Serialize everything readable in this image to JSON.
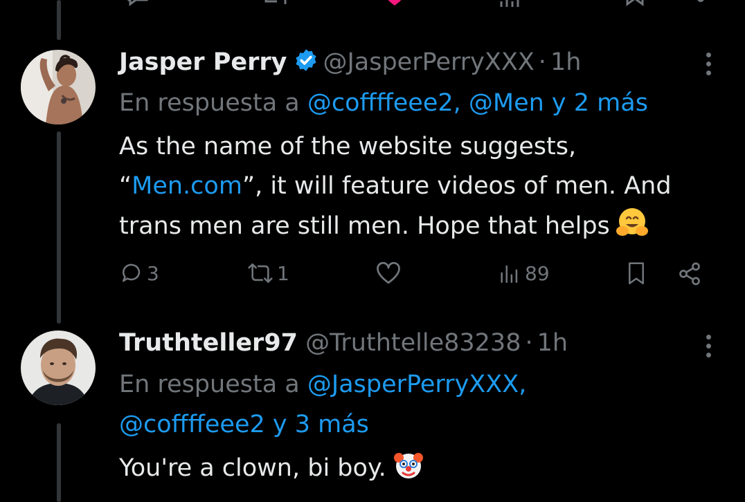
{
  "tweets": [
    {
      "name": "Jasper Perry",
      "handle": "@JasperPerryXXX",
      "separator": "·",
      "time": "1h",
      "reply_prefix": "En respuesta a",
      "reply_mentions": "@coffffeee2, @Men y 2 más",
      "body_prefix": "As the name of the website suggests,",
      "body_quote_open": "“",
      "body_link": "Men.com",
      "body_after_link": "”, it will feature videos of men. And",
      "body_line3": "trans men are still men. Hope that helps",
      "emoji": "hugging-face",
      "stats": {
        "replies": "3",
        "reposts": "1",
        "views": "89"
      }
    },
    {
      "name": "Truthteller97",
      "handle": "@Truthtelle83238",
      "separator": "·",
      "time": "1h",
      "reply_prefix": "En respuesta a",
      "reply_mentions_line1": "@JasperPerryXXX,",
      "reply_mentions_line2": "@coffffeee2 y 3 más",
      "body": "You're a clown, bi boy.",
      "emoji": "clown-face"
    }
  ],
  "colors": {
    "background": "#000000",
    "text": "#e7e9ea",
    "muted": "#71767b",
    "accent": "#1d9bf0",
    "verified": "#1d9bf0",
    "thread_line": "#333639"
  },
  "icons": {
    "reply": "speech-bubble-icon",
    "repost": "repost-arrows-icon",
    "like": "heart-icon",
    "views": "bar-chart-icon",
    "bookmark": "bookmark-icon",
    "share": "share-icon",
    "more": "more-dots-icon",
    "verified": "verified-badge-icon"
  }
}
